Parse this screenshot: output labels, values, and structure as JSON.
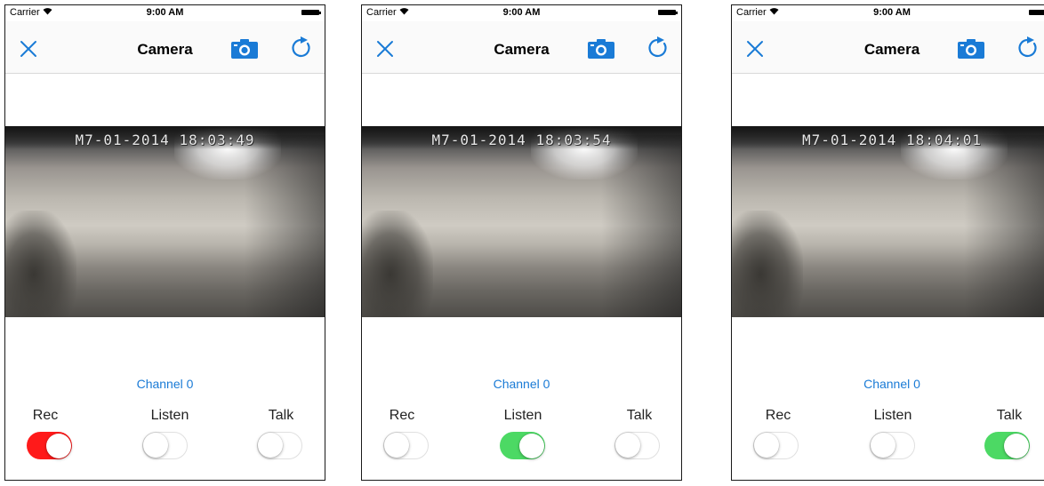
{
  "screens": [
    {
      "status": {
        "carrier": "Carrier",
        "time": "9:00 AM"
      },
      "nav": {
        "title": "Camera"
      },
      "video": {
        "timestamp": "M7-01-2014 18:03:49"
      },
      "channel": "Channel 0",
      "controls": [
        {
          "label": "Rec",
          "on": true,
          "color": "#ff1a1a"
        },
        {
          "label": "Listen",
          "on": false,
          "color": "#4cd964"
        },
        {
          "label": "Talk",
          "on": false,
          "color": "#4cd964"
        }
      ]
    },
    {
      "status": {
        "carrier": "Carrier",
        "time": "9:00 AM"
      },
      "nav": {
        "title": "Camera"
      },
      "video": {
        "timestamp": "M7-01-2014 18:03:54"
      },
      "channel": "Channel 0",
      "controls": [
        {
          "label": "Rec",
          "on": false,
          "color": "#ff1a1a"
        },
        {
          "label": "Listen",
          "on": true,
          "color": "#4cd964"
        },
        {
          "label": "Talk",
          "on": false,
          "color": "#4cd964"
        }
      ]
    },
    {
      "status": {
        "carrier": "Carrier",
        "time": "9:00 AM"
      },
      "nav": {
        "title": "Camera"
      },
      "video": {
        "timestamp": "M7-01-2014 18:04:01"
      },
      "channel": "Channel 0",
      "controls": [
        {
          "label": "Rec",
          "on": false,
          "color": "#ff1a1a"
        },
        {
          "label": "Listen",
          "on": false,
          "color": "#4cd964"
        },
        {
          "label": "Talk",
          "on": true,
          "color": "#4cd964"
        }
      ]
    }
  ],
  "icons": {
    "close": "close-icon",
    "camera": "camera-icon",
    "refresh": "refresh-icon",
    "wifi": "wifi-icon",
    "battery": "battery-icon"
  },
  "colors": {
    "accent": "#1a7bd6",
    "rec_on": "#ff1a1a",
    "switch_on": "#4cd964"
  }
}
